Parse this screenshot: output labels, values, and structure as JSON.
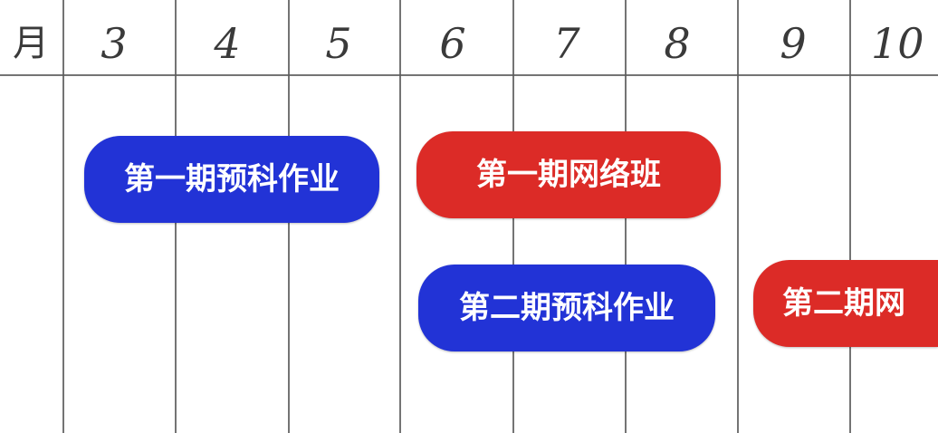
{
  "header": {
    "corner_label": "月",
    "months": [
      "3",
      "4",
      "5",
      "6",
      "7",
      "8",
      "9",
      "10"
    ]
  },
  "colors": {
    "prep": "#2233d6",
    "course": "#dc2b27",
    "grid": "#5c5c5c"
  },
  "tasks": [
    {
      "label": "第一期预科作业",
      "type": "prep"
    },
    {
      "label": "第一期网络班",
      "type": "course"
    },
    {
      "label": "第二期预科作业",
      "type": "prep"
    },
    {
      "label": "第二期网",
      "type": "course"
    }
  ]
}
